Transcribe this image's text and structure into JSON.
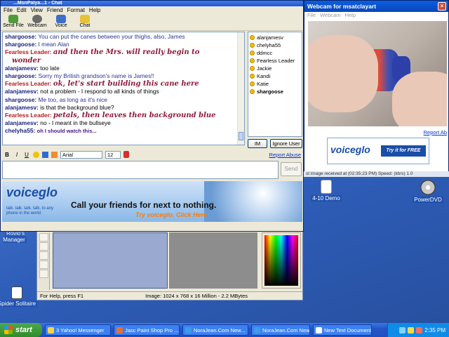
{
  "chat_window": {
    "title": "...MsnPalya...1 - Chat",
    "menu": [
      "File",
      "Edit",
      "View",
      "Friend",
      "Format",
      "Help"
    ],
    "toolbar": [
      {
        "label": "Send File",
        "icon": "send-file-icon"
      },
      {
        "label": "Webcam",
        "icon": "webcam-icon"
      },
      {
        "label": "Voice",
        "icon": "voice-icon"
      },
      {
        "label": "Chat",
        "icon": "chat-icon"
      }
    ],
    "messages": [
      {
        "user": "shargoose:",
        "text": "You can put the canes between your thighs, also, James",
        "style": "blue"
      },
      {
        "user": "shargoose:",
        "text": "I mean Alan",
        "style": "blue"
      },
      {
        "user": "Fearless Leader:",
        "text": "and then the Mrs. will really begin to",
        "style": "script"
      },
      {
        "user": "",
        "text": "wonder",
        "style": "script"
      },
      {
        "user": "alanjamesv:",
        "text": "too late",
        "style": "plain"
      },
      {
        "user": "shargoose:",
        "text": "Sorry my British grandson's name is James!!",
        "style": "blue"
      },
      {
        "user": "Fearless Leader:",
        "text": "ok, let's start building this cane here",
        "style": "script"
      },
      {
        "user": "alanjamesv:",
        "text": "not a problem - I respond to all kinds of things",
        "style": "plain"
      },
      {
        "user": "shargoose:",
        "text": "Me too, as long as it's nice",
        "style": "blue"
      },
      {
        "user": "alanjamesv:",
        "text": "is that the background blue?",
        "style": "plain"
      },
      {
        "user": "Fearless Leader:",
        "text": "petals, then leaves then background blue",
        "style": "script"
      },
      {
        "user": "alanjamesv:",
        "text": "no - I meant in the bullseye",
        "style": "plain"
      },
      {
        "user": "chelyha55:",
        "text": "oh I should watch this...",
        "style": "small"
      }
    ],
    "users": [
      "alanjamesv",
      "chelyha55",
      "ddmcc",
      "Fearless Leader",
      "Jackie",
      "Kandi",
      "Katie",
      "shargoose"
    ],
    "im_label": "IM",
    "ignore_label": "Ignore User",
    "format": {
      "bold": "B",
      "italic": "I",
      "underline": "U",
      "font": "Arial",
      "size": "12"
    },
    "report_abuse": "Report Abuse",
    "send_label": "Send",
    "ad": {
      "logo": "voiceglo",
      "tagline": "talk. talk. talk. talk. to any phone in the world",
      "headline": "Call your friends for next to nothing.",
      "cta": "Try voiceglo. Click Here"
    }
  },
  "webcam_window": {
    "title": "Webcam for msatclayart",
    "menu": [
      "File",
      "Webcam",
      "Help"
    ],
    "report_link": "Report Ab",
    "ad_logo": "voiceglo",
    "ad_cta": "Try it for FREE now.",
    "status_partial": "st image received at (02:35:23 PM)          Speed: (kb/s) 1.0"
  },
  "paint_window": {
    "help_text": "For Help, press F1",
    "image_info": "Image:  1024 x 768 x 16 Million - 2.2 MBytes"
  },
  "desktop": {
    "icons": [
      {
        "label": "4-10 Demo",
        "icon": "text-document-icon"
      },
      {
        "label": "PowerDVD",
        "icon": "powerdvd-icon"
      },
      {
        "label": "Spider Solitaire",
        "icon": "spider-solitaire-icon"
      },
      {
        "label": "Rovio's Manager",
        "icon": "manager-icon"
      }
    ]
  },
  "taskbar": {
    "start_label": "start",
    "tasks": [
      {
        "label": "3 Yahoo! Messenger"
      },
      {
        "label": "Jasc Paint Shop Pro ..."
      },
      {
        "label": "NoraJean.Com New..."
      },
      {
        "label": "NoraJean.Com New..."
      },
      {
        "label": "New Text Document..."
      }
    ],
    "clock": "2:35 PM"
  }
}
